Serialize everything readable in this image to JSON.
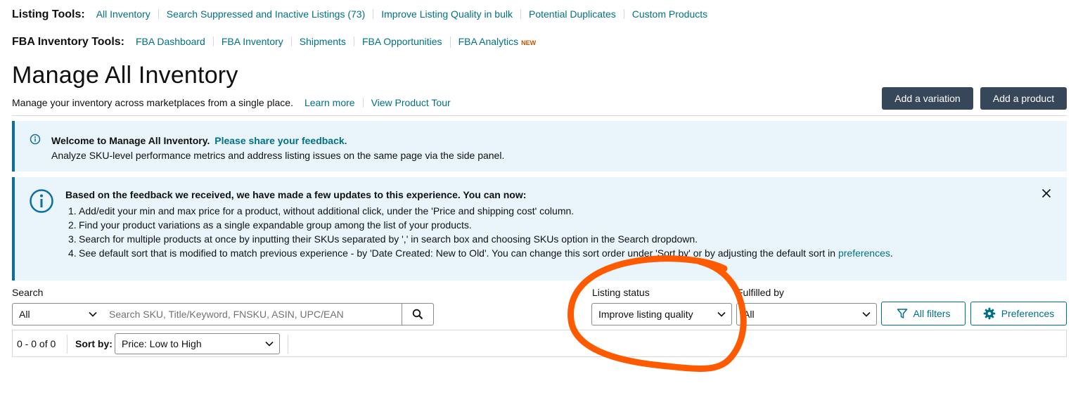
{
  "listing_tools": {
    "title": "Listing Tools:",
    "links": [
      "All Inventory",
      "Search Suppressed and Inactive Listings (73)",
      "Improve Listing Quality in bulk",
      "Potential Duplicates",
      "Custom Products"
    ]
  },
  "fba_tools": {
    "title": "FBA Inventory Tools:",
    "links": [
      "FBA Dashboard",
      "FBA Inventory",
      "Shipments",
      "FBA Opportunities",
      "FBA Analytics"
    ],
    "new_badge": "NEW"
  },
  "header": {
    "title": "Manage All Inventory",
    "subtitle": "Manage your inventory across marketplaces from a single place.",
    "learn_more": "Learn more",
    "product_tour": "View Product Tour",
    "add_variation": "Add a variation",
    "add_product": "Add a product"
  },
  "welcome_banner": {
    "title": "Welcome to Manage All Inventory.",
    "feedback_link": "Please share your feedback.",
    "text": "Analyze SKU-level performance metrics and address listing issues on the same page via the side panel."
  },
  "update_banner": {
    "heading": "Based on the feedback we received, we have made a few updates to this experience. You can now:",
    "items": [
      {
        "num": "1.",
        "text": "Add/edit your min and max price for a product, without additional click, under the 'Price and shipping cost' column."
      },
      {
        "num": "2.",
        "text": "Find your product variations as a single expandable group among the list of your products."
      },
      {
        "num": "3.",
        "text": "Search for multiple products at once by inputting their SKUs separated by ',' in search box and choosing SKUs option in the Search dropdown."
      },
      {
        "num": "4.",
        "text": "See default sort that is modified to match previous experience - by 'Date Created: New to Old'. You can change this sort order under 'Sort by' or by adjusting the default sort in ",
        "link": "preferences",
        "tail": "."
      }
    ]
  },
  "filters": {
    "search_label": "Search",
    "search_scope": "All",
    "search_placeholder": "Search SKU, Title/Keyword, FNSKU, ASIN, UPC/EAN",
    "listing_status_label": "Listing status",
    "listing_status_value": "Improve listing quality",
    "fulfilled_by_label": "Fulfilled by",
    "fulfilled_by_value": "All",
    "all_filters": "All filters",
    "preferences": "Preferences"
  },
  "results": {
    "count": "0 - 0 of 0",
    "sort_label": "Sort by:",
    "sort_value": "Price: Low to High"
  },
  "colors": {
    "link": "#007185",
    "dark_button": "#37475a",
    "banner_bg": "#e9f5fb",
    "banner_accent": "#0b6fa4",
    "annotation": "#ff5a00"
  }
}
